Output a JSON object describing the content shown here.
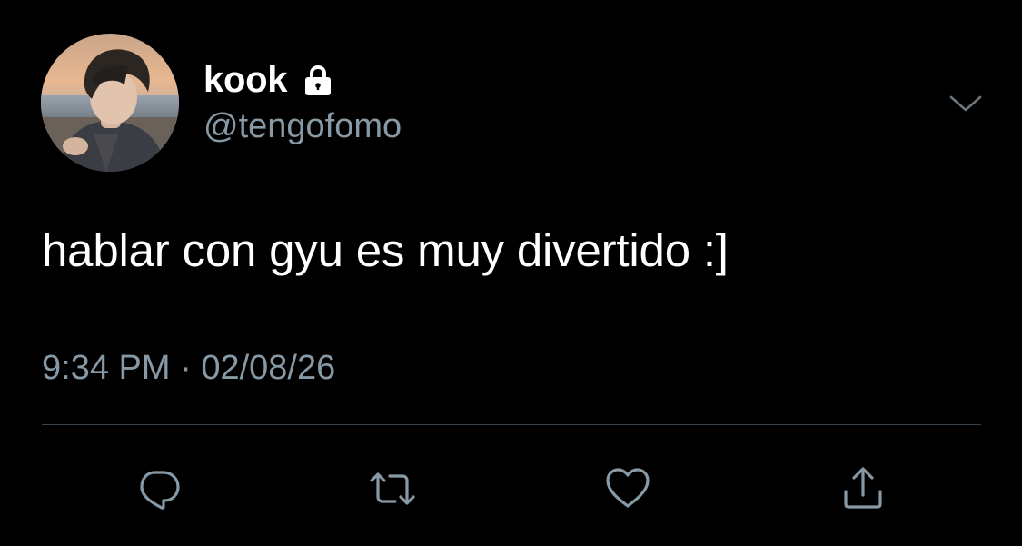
{
  "tweet": {
    "author": {
      "display_name": "kook",
      "handle": "@tengofomo",
      "protected_icon": "lock-icon",
      "avatar": "profile-photo"
    },
    "text": "hablar con gyu es muy divertido :]",
    "time": "9:34 PM",
    "separator": "·",
    "date": "02/08/26",
    "menu_icon": "chevron-down-icon",
    "actions": [
      {
        "name": "reply",
        "icon": "reply-icon"
      },
      {
        "name": "retweet",
        "icon": "retweet-icon"
      },
      {
        "name": "like",
        "icon": "heart-icon"
      },
      {
        "name": "share",
        "icon": "share-icon"
      }
    ]
  },
  "colors": {
    "background": "#000000",
    "text_primary": "#ffffff",
    "text_secondary": "#8899a6",
    "divider": "#38444d"
  }
}
